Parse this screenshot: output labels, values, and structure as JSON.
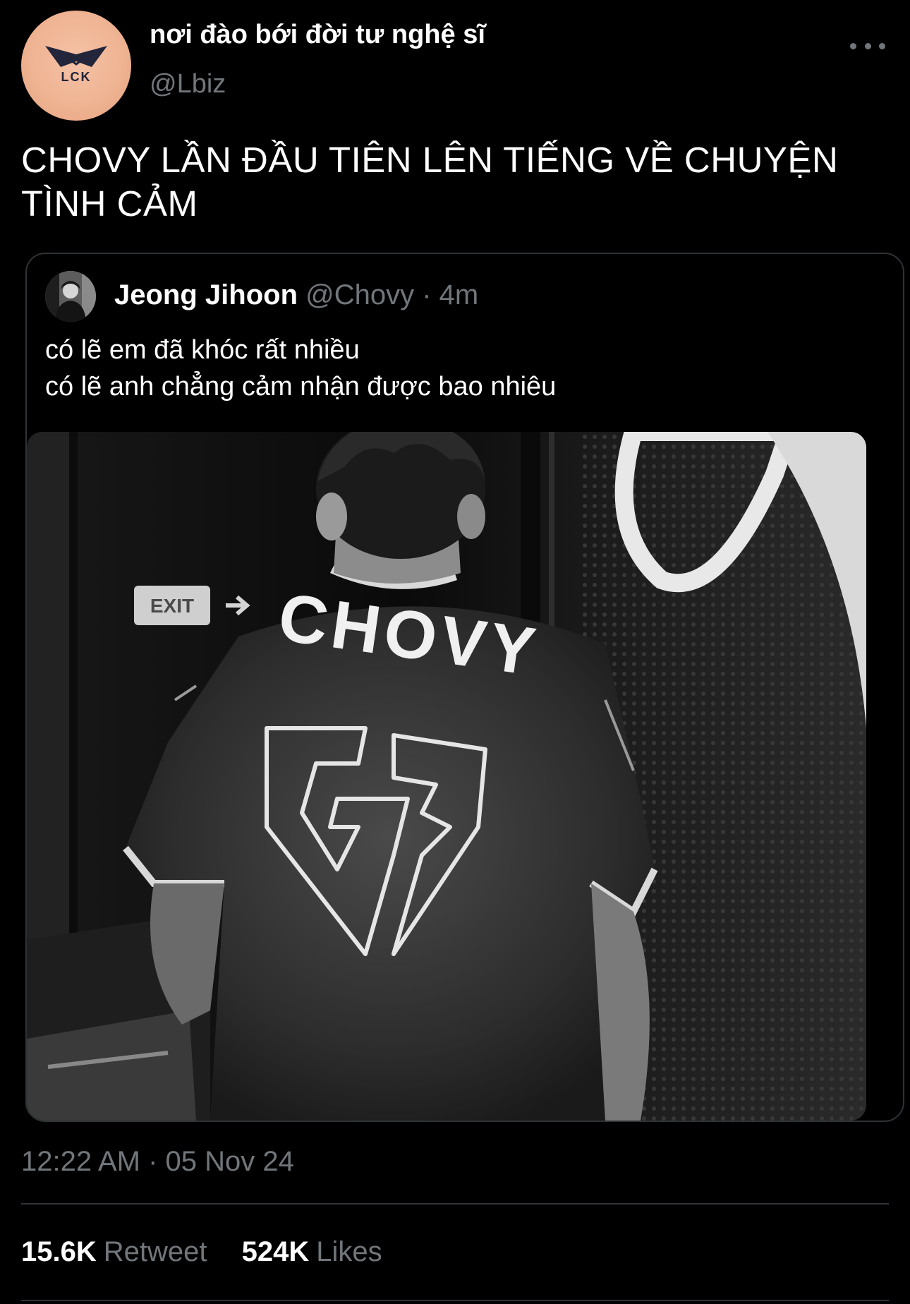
{
  "header": {
    "display_name": "nơi đào bới đời tư nghệ sĩ",
    "handle": "@Lbiz",
    "avatar_logo_text": "LCK",
    "more_icon": "more-horizontal-icon"
  },
  "tweet": {
    "text_line1": "CHOVY LẦN ĐẦU TIÊN LÊN TIẾNG VỀ CHUYỆN",
    "text_line2": "TÌNH CẢM"
  },
  "quote": {
    "name": "Jeong Jihoon",
    "handle": "@Chovy",
    "separator": " · ",
    "time": "4m",
    "text_line1": "có lẽ em đã khóc rất nhiều",
    "text_line2": "có lẽ anh chẳng cảm nhận được bao nhiêu",
    "media": {
      "jersey_name": "CHOVY",
      "sign_text": "EXIT"
    }
  },
  "footer": {
    "timestamp": "12:22 AM · 05 Nov 24",
    "retweets_count": "15.6K",
    "retweets_label": "Retweet",
    "likes_count": "524K",
    "likes_label": "Likes"
  },
  "colors": {
    "background": "#000000",
    "text_primary": "#ffffff",
    "text_secondary": "#71767b",
    "border": "#2f3336",
    "avatar_bg": "#efb493"
  }
}
